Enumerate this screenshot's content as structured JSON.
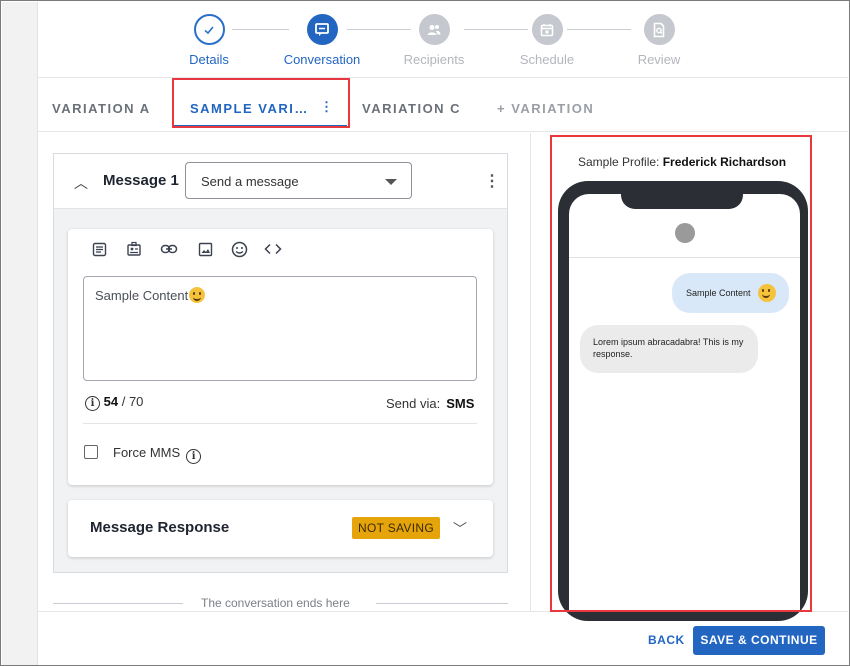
{
  "stepper": {
    "steps": [
      {
        "label": "Details",
        "state": "done",
        "icon": "check-icon"
      },
      {
        "label": "Conversation",
        "state": "active",
        "icon": "chat-icon"
      },
      {
        "label": "Recipients",
        "state": "pending",
        "icon": "users-icon"
      },
      {
        "label": "Schedule",
        "state": "pending",
        "icon": "calendar-icon"
      },
      {
        "label": "Review",
        "state": "pending",
        "icon": "review-doc-icon"
      }
    ]
  },
  "tabs": {
    "variation_a": "VARIATION A",
    "sample_variation": "SAMPLE VARI…",
    "variation_c": "VARIATION C",
    "add_variation": "+ VARIATION"
  },
  "message": {
    "title": "Message 1",
    "type_select": "Send a message",
    "content": "Sample Content",
    "count": "54",
    "max": "/ 70",
    "send_via_label": "Send via:",
    "send_via_value": "SMS",
    "force_mms": "Force MMS",
    "force_mms_checked": false
  },
  "response": {
    "title": "Message Response",
    "badge": "NOT SAVING"
  },
  "end_text": "The conversation ends here",
  "footer": {
    "back": "BACK",
    "save": "SAVE & CONTINUE"
  },
  "preview": {
    "profile_label": "Sample Profile:",
    "profile_name": "Frederick Richardson",
    "outgoing": "Sample Content",
    "incoming": "Lorem ipsum abracadabra! This is my response."
  },
  "colors": {
    "accent": "#2266c2",
    "badge": "#e5a50a",
    "highlight_box": "#e8383e"
  }
}
